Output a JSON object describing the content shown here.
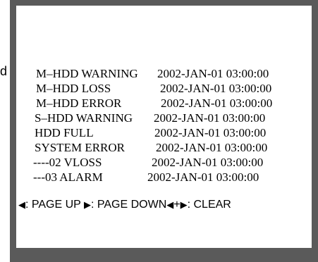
{
  "edge_mark": "d",
  "event_log": [
    {
      "event": "M–HDD WARNING",
      "time": "2002-JAN-01 03:00:00"
    },
    {
      "event": "M–HDD LOSS",
      "time": "2002-JAN-01 03:00:00"
    },
    {
      "event": "M–HDD ERROR",
      "time": "2002-JAN-01 03:00:00"
    },
    {
      "event": "S–HDD WARNING",
      "time": "2002-JAN-01 03:00:00"
    },
    {
      "event": "HDD FULL",
      "time": "2002-JAN-01 03:00:00"
    },
    {
      "event": "SYSTEM ERROR",
      "time": "2002-JAN-01 03:00:00"
    },
    {
      "event": "----02 VLOSS",
      "time": "2002-JAN-01 03:00:00"
    },
    {
      "event": "---03 ALARM",
      "time": "2002-JAN-01 03:00:00"
    }
  ],
  "nav": {
    "left_arrow": "◀",
    "right_arrow": "▶",
    "page_up_label": ": PAGE UP",
    "page_down_label": ": PAGE DOWN",
    "plus": "+",
    "clear_label": ": CLEAR"
  },
  "colors": {
    "frame": "#5a5a5a",
    "screen": "#ffffff",
    "text": "#000000"
  }
}
